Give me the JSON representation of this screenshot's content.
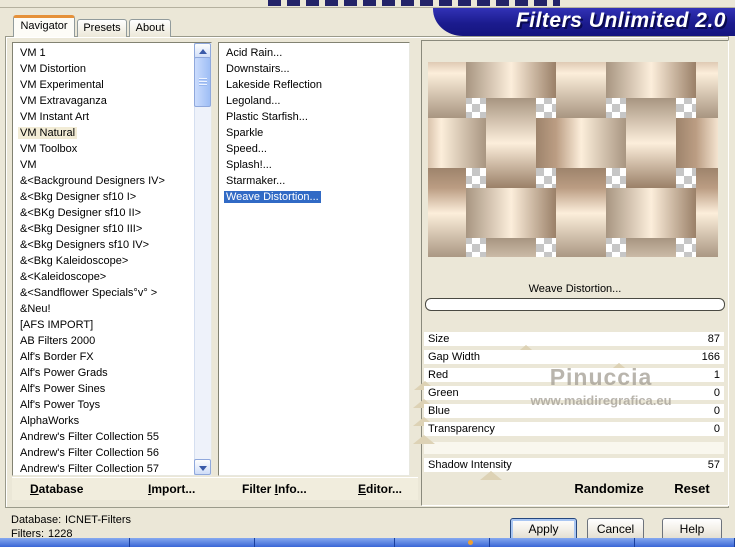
{
  "banner": {
    "title": "Filters Unlimited 2.0"
  },
  "tabs": [
    {
      "label": "Navigator",
      "active": true
    },
    {
      "label": "Presets",
      "active": false
    },
    {
      "label": "About",
      "active": false
    }
  ],
  "left_list": {
    "selected": "VM Natural",
    "items": [
      "VM 1",
      "VM Distortion",
      "VM Experimental",
      "VM Extravaganza",
      "VM Instant Art",
      "VM Natural",
      "VM Toolbox",
      "VM",
      "&<Background Designers IV>",
      "&<Bkg Designer sf10 I>",
      "&<BKg Designer sf10 II>",
      "&<Bkg Designer sf10 III>",
      "&<Bkg Designers sf10 IV>",
      "&<Bkg Kaleidoscope>",
      "&<Kaleidoscope>",
      "&<Sandflower Specials°v° >",
      "&Neu!",
      "[AFS IMPORT]",
      "AB Filters 2000",
      "Alf's Border FX",
      "Alf's Power Grads",
      "Alf's Power Sines",
      "Alf's Power Toys",
      "AlphaWorks",
      "Andrew's Filter Collection 55",
      "Andrew's Filter Collection 56",
      "Andrew's Filter Collection 57"
    ]
  },
  "filter_list": {
    "selected": "Weave Distortion...",
    "items": [
      "Acid Rain...",
      "Downstairs...",
      "Lakeside Reflection",
      "Legoland...",
      "Plastic Starfish...",
      "Sparkle",
      "Speed...",
      "Splash!...",
      "Starmaker...",
      "Weave Distortion..."
    ]
  },
  "preview": {
    "caption": "Weave Distortion..."
  },
  "sliders": [
    {
      "label": "Size",
      "value": 87,
      "max": 255
    },
    {
      "label": "Gap Width",
      "value": 166,
      "max": 255
    },
    {
      "label": "Red",
      "value": 1,
      "max": 255
    },
    {
      "label": "Green",
      "value": 0,
      "max": 255
    },
    {
      "label": "Blue",
      "value": 0,
      "max": 255
    },
    {
      "label": "Transparency",
      "value": 0,
      "max": 255
    }
  ],
  "shadow_sliders": [
    {
      "label": "Shadow Intensity",
      "value": 57,
      "max": 255
    }
  ],
  "actions": {
    "randomize": "Randomize",
    "reset": "Reset"
  },
  "menu": [
    {
      "name": "database",
      "pre": "",
      "u": "D",
      "post": "atabase"
    },
    {
      "name": "import",
      "pre": "",
      "u": "I",
      "post": "mport..."
    },
    {
      "name": "filter-info",
      "pre": "Filter ",
      "u": "I",
      "post": "nfo..."
    },
    {
      "name": "editor",
      "pre": "",
      "u": "E",
      "post": "ditor..."
    }
  ],
  "status": {
    "database_label": "Database:",
    "database_value": "ICNET-Filters",
    "filters_label": "Filters:",
    "filters_value": "1228"
  },
  "buttons": {
    "apply": "Apply",
    "cancel": "Cancel",
    "help": "Help"
  },
  "watermark": {
    "line1": "Pinuccia",
    "line2": "www.maidiregrafica.eu"
  },
  "colors": {
    "banner_blue": "#1b1b8e",
    "selection_blue": "#316ac5",
    "inactive_selection": "#f2ecd6",
    "weave_dark": "#79644f",
    "weave_light": "#fceedb",
    "checker_gray": "#c6c6c6",
    "marker_beige": "#ddd2b5"
  }
}
